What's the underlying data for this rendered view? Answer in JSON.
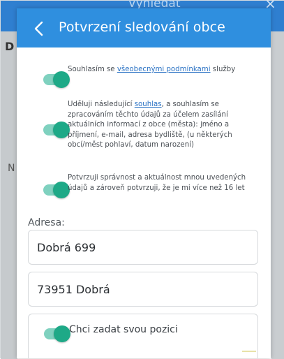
{
  "background": {
    "app_title": "Vyhledat",
    "left_letter_top": "D",
    "left_letter_mid": "N",
    "close_glyph": "×"
  },
  "modal": {
    "title": "Potvrzení sledování obce",
    "back_icon": "chevron-left-icon"
  },
  "consents": [
    {
      "checked": true,
      "before": "Souhlasím se ",
      "link": "všeobecnými podmínkami",
      "after": " služby"
    },
    {
      "checked": true,
      "before": "Uděluji následující ",
      "link": "souhlas",
      "after": ", a souhlasím se zpracováním těchto údajů za účelem zasílání aktuálních informací z obce (města): jméno a příjmení, e-mail, adresa bydliště, (u některých obcí/měst pohlaví, datum narození)"
    },
    {
      "checked": true,
      "text": "Potvrzuji správnost a aktuálnost mnou uvedených údajů a zároveň potvrzuji, že je mi více než 16 let"
    }
  ],
  "address": {
    "label": "Adresa:",
    "street": "Dobrá 699",
    "city": "73951 Dobrá"
  },
  "position": {
    "toggle_checked": true,
    "label": "Chci zadat svou pozici"
  },
  "colors": {
    "header": "#2f8fdf",
    "toggle_track": "#7fd1bf",
    "toggle_knob": "#1ea987",
    "link": "#2a72c4"
  }
}
